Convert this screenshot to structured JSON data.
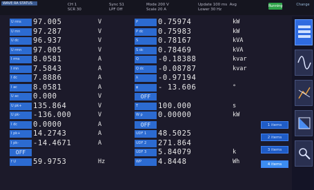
{
  "header": {
    "brand": "WAVE RA STATUS",
    "block1": "CH 1\nSCR 30",
    "block2": "Sync S1\nLPF Off",
    "block3": "Mode 200 V\nScale 20 A",
    "block4": "Update 100 ms  Avg\nLower 30 Hz",
    "status": "Running",
    "right": "Change"
  },
  "left_rows": [
    {
      "label": "U rms",
      "value": "97.005",
      "unit": "V"
    },
    {
      "label": "U mn",
      "value": "97.287",
      "unit": "V"
    },
    {
      "label": "U dc",
      "value": "96.937",
      "unit": "V"
    },
    {
      "label": "U rmn",
      "value": "97.005",
      "unit": "V"
    },
    {
      "label": "I rms",
      "value": "8.0581",
      "unit": "A"
    },
    {
      "label": "I mn",
      "value": "7.5843",
      "unit": "A"
    },
    {
      "label": "I dc",
      "value": "7.8886",
      "unit": "A"
    },
    {
      "label": "I ac",
      "value": "8.0581",
      "unit": "A"
    },
    {
      "label": "U ac",
      "value": "0.000",
      "unit": "V"
    },
    {
      "label": "U pk+",
      "value": "135.864",
      "unit": "V"
    },
    {
      "label": "U pk-",
      "value": "-136.000",
      "unit": "V"
    },
    {
      "label": "I dc",
      "value": "0.0000",
      "unit": "A"
    },
    {
      "label": "I pk+",
      "value": "14.2743",
      "unit": "A"
    },
    {
      "label": "I pk-",
      "value": "-14.4671",
      "unit": "A"
    },
    {
      "off": "OFF"
    },
    {
      "label": "f U",
      "value": "59.9753",
      "unit": "Hz"
    }
  ],
  "right_rows": [
    {
      "label": "P",
      "value": "0.75974",
      "unit": "kW"
    },
    {
      "label": "P dc",
      "value": "0.75983",
      "unit": "kW"
    },
    {
      "label": "S",
      "value": "0.78167",
      "unit": "kVA"
    },
    {
      "label": "S dc",
      "value": "0.78469",
      "unit": "kVA"
    },
    {
      "label": "Q",
      "value": "-0.18388",
      "unit": "kvar"
    },
    {
      "label": "Q dc",
      "value": "-0.08787",
      "unit": "kvar"
    },
    {
      "label": "λ",
      "value": "-0.97194",
      "unit": ""
    },
    {
      "label": "φ",
      "value": "- 13.606",
      "unit": "°"
    },
    {
      "off": "OFF"
    },
    {
      "label": "T",
      "value": "100.000",
      "unit": "s"
    },
    {
      "label": "W p",
      "value": "0.00000",
      "unit": "kW"
    },
    {
      "off": "OFF"
    },
    {
      "label": "UDF 1",
      "value": "48.5025",
      "unit": ""
    },
    {
      "label": "UDF 2",
      "value": "271.864",
      "unit": ""
    },
    {
      "label": "UDF 3",
      "value": "5.84079",
      "unit": "k"
    },
    {
      "label": "WP",
      "value": "4.8448",
      "unit": "Wh"
    }
  ],
  "page_buttons": [
    "1 items",
    "2 items",
    "3 items",
    "4 items"
  ],
  "sidebar_icons": [
    "panel-icon",
    "waveform-icon",
    "chart-icon",
    "trend-icon",
    "settings-icon"
  ]
}
